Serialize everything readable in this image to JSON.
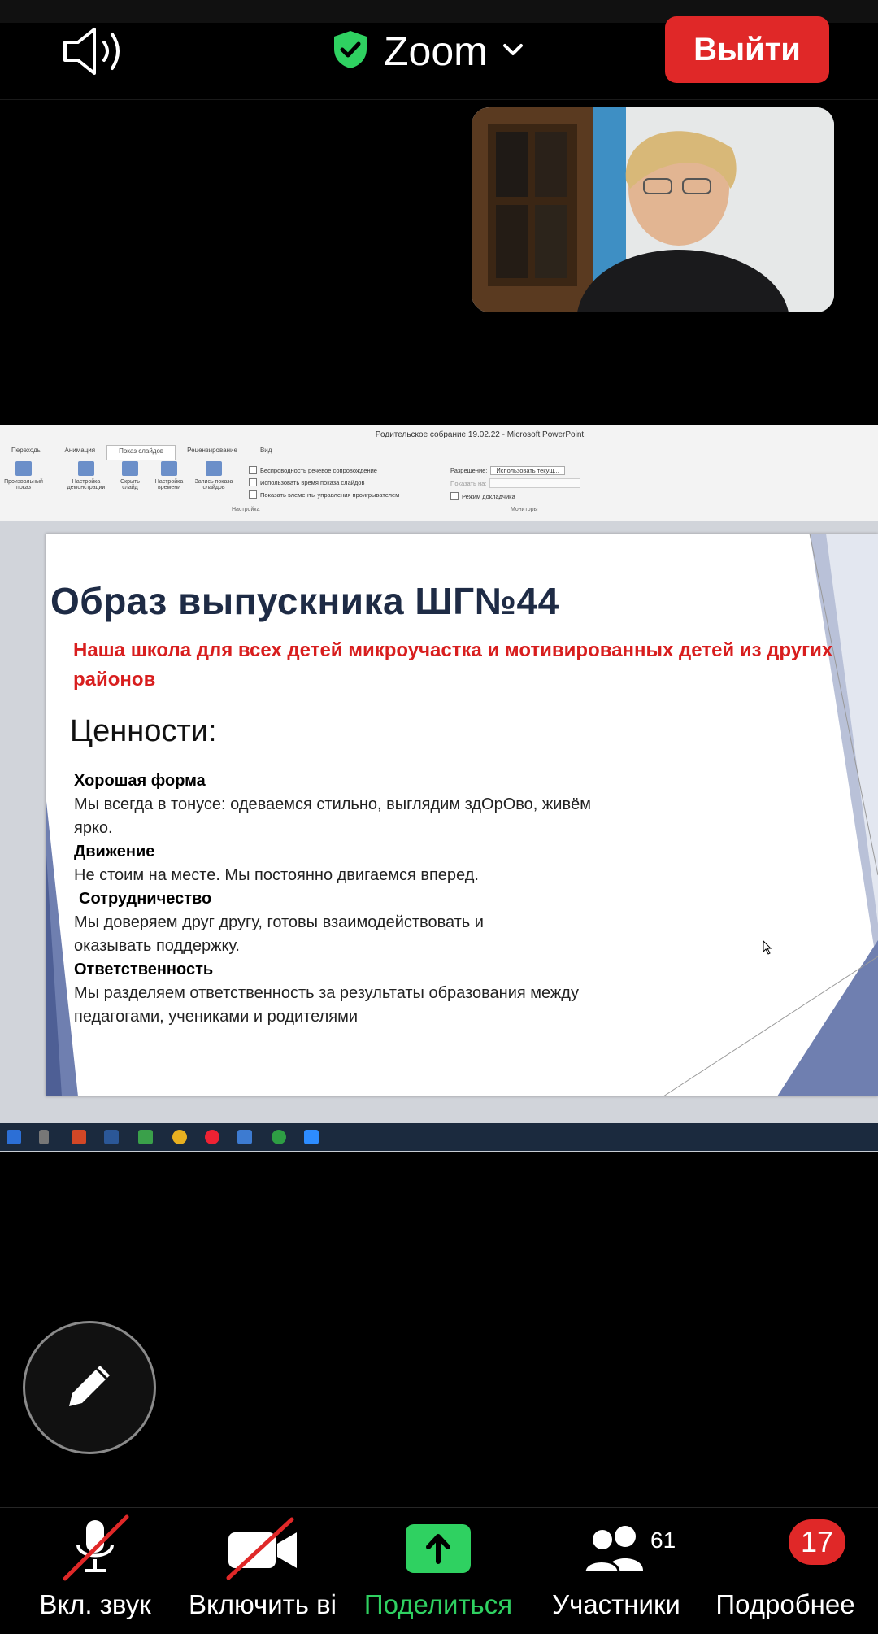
{
  "topbar": {
    "title": "Zoom",
    "leave_label": "Выйти"
  },
  "ppt": {
    "window_title": "Родительское собрание 19.02.22  -  Microsoft PowerPoint",
    "tabs": [
      "Переходы",
      "Анимация",
      "Показ слайдов",
      "Рецензирование",
      "Вид"
    ],
    "active_tab": "Показ слайдов",
    "buttons": [
      "Произвольный показ",
      "Настройка демонстрации",
      "Скрыть слайд",
      "Настройка времени",
      "Запись показа слайдов"
    ],
    "checks": [
      "Беспроводность речевое сопровождение",
      "Использовать время показа слайдов",
      "Показать элементы управления проигрывателем"
    ],
    "group_settings": "Настройка",
    "resolution_label": "Разрешение:",
    "resolution_value": "Использовать текущ...",
    "show_on_label": "Показать на:",
    "presenter_mode": "Режим докладчика",
    "group_monitors": "Мониторы"
  },
  "slide": {
    "title": "Образ выпускника ШГ№44",
    "subtitle": "Наша школа для всех детей микроучастка и мотивированных детей из других районов",
    "values_heading": "Ценности:",
    "values": [
      {
        "heading": "Хорошая форма",
        "text": "Мы всегда в тонусе: одеваемся стильно, выглядим здОрОво, живём ярко."
      },
      {
        "heading": "Движение",
        "text": "Не стоим на месте. Мы постоянно двигаемся вперед."
      },
      {
        "heading": "Сотрудничество",
        "text": "Мы доверяем друг другу, готовы взаимодействовать и оказывать поддержку."
      },
      {
        "heading": "Ответственность",
        "text": "Мы разделяем ответственность за результаты образования между педагогами, учениками и родителями"
      }
    ]
  },
  "toolbar": {
    "mute_label": "Вкл. звук",
    "video_label": "Включить ві",
    "share_label": "Поделиться",
    "participants_label": "Участники",
    "participants_count": "61",
    "more_label": "Подробнее",
    "more_badge": "17"
  },
  "colors": {
    "leave": "#e02828",
    "share": "#2fd161",
    "shield": "#2fd161",
    "slide_title": "#1e2b45",
    "slide_subtitle": "#d81e1e",
    "slide_accent": "#6f7fb0"
  },
  "icons": [
    "speaker-icon",
    "shield-check-icon",
    "chevron-down-icon",
    "pencil-icon",
    "microphone-muted-icon",
    "video-off-icon",
    "share-arrow-icon",
    "participants-icon",
    "more-dots-icon"
  ]
}
